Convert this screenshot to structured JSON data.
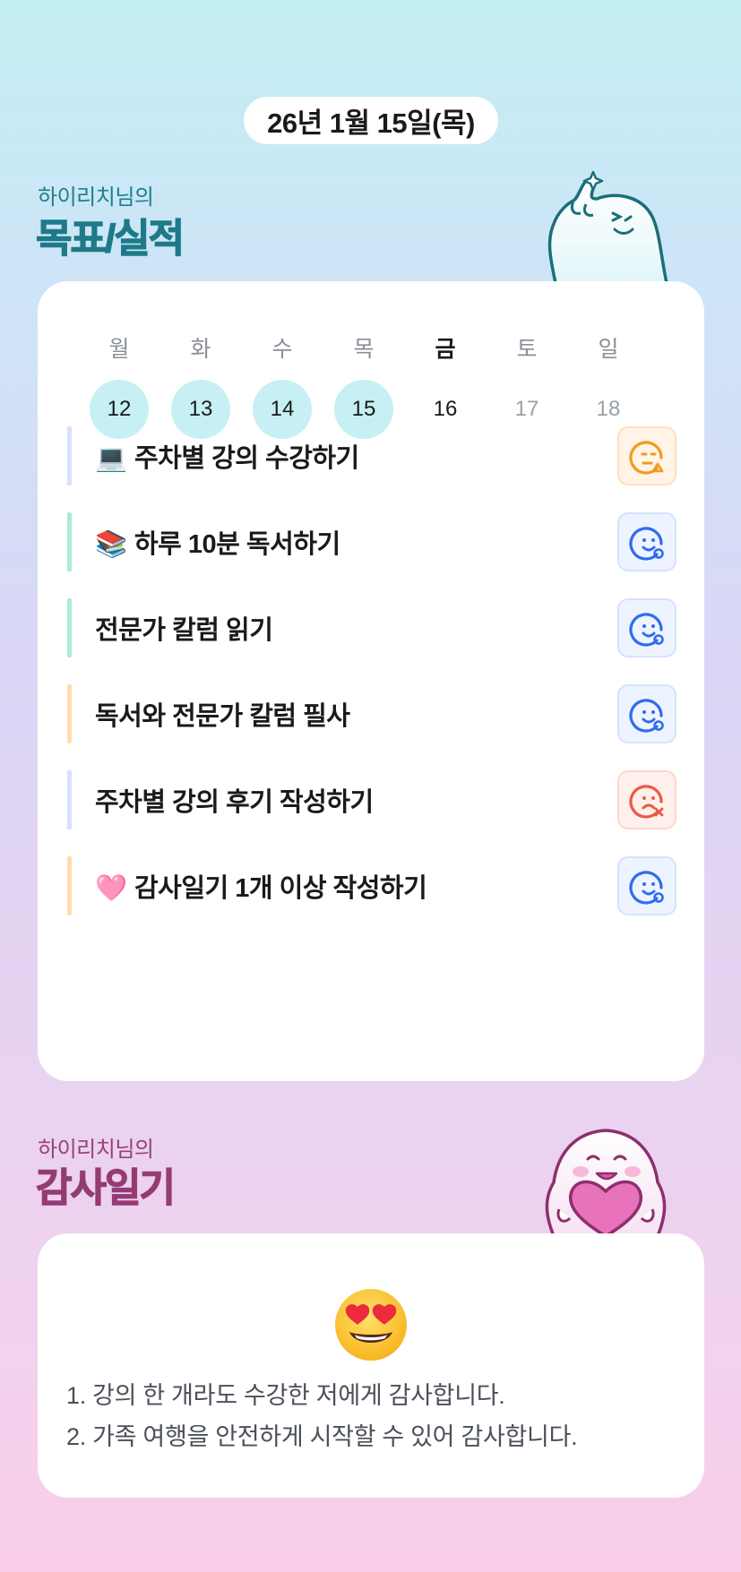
{
  "header": {
    "date": "26년 1월 15일(목)"
  },
  "goals_section": {
    "subtitle": "하이리치님의",
    "title": "목표/실적"
  },
  "week": [
    {
      "name": "월",
      "num": "12",
      "state": "done"
    },
    {
      "name": "화",
      "num": "13",
      "state": "done"
    },
    {
      "name": "수",
      "num": "14",
      "state": "done"
    },
    {
      "name": "목",
      "num": "15",
      "state": "done"
    },
    {
      "name": "금",
      "num": "16",
      "state": "today"
    },
    {
      "name": "토",
      "num": "17",
      "state": "future"
    },
    {
      "name": "일",
      "num": "18",
      "state": "future"
    }
  ],
  "goals": [
    {
      "emoji": "💻",
      "label": "주차별 강의 수강하기",
      "bar_color": "#d8e1fb",
      "status": "partial",
      "icon": "smile-triangle-icon"
    },
    {
      "emoji": "📚",
      "label": "하루 10분 독서하기",
      "bar_color": "#a8ecd9",
      "status": "good",
      "icon": "smile-circle-icon"
    },
    {
      "emoji": "",
      "label": "전문가 칼럼 읽기",
      "bar_color": "#a8ecd9",
      "status": "good",
      "icon": "smile-circle-icon"
    },
    {
      "emoji": "",
      "label": "독서와 전문가 칼럼 필사",
      "bar_color": "#ffdcb0",
      "status": "good",
      "icon": "smile-circle-icon"
    },
    {
      "emoji": "",
      "label": "주차별 강의 후기 작성하기",
      "bar_color": "#d8e1fb",
      "status": "bad",
      "icon": "sad-x-icon"
    },
    {
      "emoji": "🩷",
      "label": "감사일기 1개 이상 작성하기",
      "bar_color": "#ffdcb0",
      "status": "good",
      "icon": "smile-circle-icon"
    }
  ],
  "gratitude_section": {
    "subtitle": "하이리치님의",
    "title": "감사일기"
  },
  "gratitude": {
    "emoji": "heart-eyes-emoji",
    "items": [
      "1. 강의 한 개라도 수강한 저에게 감사합니다.",
      "2. 가족 여행을 안전하게 시작할 수 있어 감사합니다."
    ]
  },
  "colors": {
    "goal_accent": "#1e7a88",
    "gratitude_accent": "#953b74",
    "partial": "#f29a1f",
    "good": "#2f6cf0",
    "bad": "#ea5a45"
  }
}
